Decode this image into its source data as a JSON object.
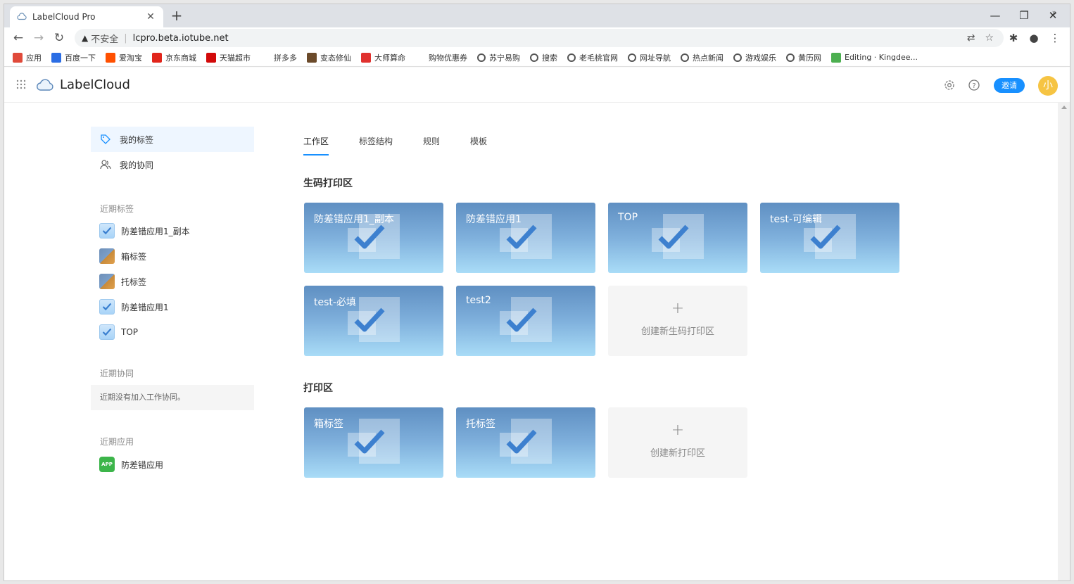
{
  "browser": {
    "tab_title": "LabelCloud Pro",
    "insecure_label": "不安全",
    "url": "lcpro.beta.iotube.net",
    "bookmarks": [
      {
        "label": "应用",
        "color": "#e04a3a",
        "icon": "apps-grid-icon"
      },
      {
        "label": "百度一下",
        "color": "#2b6de4",
        "icon": "paw-icon"
      },
      {
        "label": "爱淘宝",
        "color": "#ff5000",
        "icon": "taobao-icon"
      },
      {
        "label": "京东商城",
        "color": "#e1251b",
        "icon": "jd-icon"
      },
      {
        "label": "天猫超市",
        "color": "#d20a0a",
        "icon": "tmall-icon"
      },
      {
        "label": "拼多多",
        "color": "#ffffff",
        "icon": "blank-icon"
      },
      {
        "label": "变态修仙",
        "color": "#6b4a2a",
        "icon": "game-icon"
      },
      {
        "label": "大师算命",
        "color": "#e0312e",
        "icon": "yinyang-icon"
      },
      {
        "label": "购物优惠券",
        "color": "#ffffff",
        "icon": "blank-icon"
      },
      {
        "label": "苏宁易购",
        "color": "#555555",
        "icon": "globe-icon"
      },
      {
        "label": "搜索",
        "color": "#555555",
        "icon": "globe-icon"
      },
      {
        "label": "老毛桃官网",
        "color": "#555555",
        "icon": "globe-icon"
      },
      {
        "label": "网址导航",
        "color": "#555555",
        "icon": "globe-icon"
      },
      {
        "label": "热点新闻",
        "color": "#555555",
        "icon": "globe-icon"
      },
      {
        "label": "游戏娱乐",
        "color": "#555555",
        "icon": "globe-icon"
      },
      {
        "label": "黄历网",
        "color": "#555555",
        "icon": "globe-icon"
      },
      {
        "label": "Editing · Kingdee...",
        "color": "#4caf50",
        "icon": "edit-icon"
      }
    ],
    "bookmarks_more": "»",
    "new_tab": "+",
    "close": "✕",
    "minimize": "—",
    "restore": "❐",
    "window_close": "✕"
  },
  "header": {
    "brand": "LabelCloud",
    "invite_label": "邀请",
    "avatar_text": "小"
  },
  "sidebar": {
    "my_labels": "我的标签",
    "my_collab": "我的协同",
    "recent_labels_title": "近期标签",
    "recent_labels": [
      {
        "name": "防差错应用1_副本",
        "kind": "check"
      },
      {
        "name": "箱标签",
        "kind": "box"
      },
      {
        "name": "托标签",
        "kind": "box"
      },
      {
        "name": "防差错应用1",
        "kind": "check"
      },
      {
        "name": "TOP",
        "kind": "check"
      }
    ],
    "recent_collab_title": "近期协同",
    "recent_collab_empty": "近期没有加入工作协同。",
    "recent_apps_title": "近期应用",
    "app_badge": "APP",
    "recent_app": "防差错应用"
  },
  "main": {
    "tabs": [
      "工作区",
      "标签结构",
      "规则",
      "模板"
    ],
    "section1_title": "生码打印区",
    "section1_cards": [
      "防差错应用1_副本",
      "防差错应用1",
      "TOP",
      "test-可编辑",
      "test-必填",
      "test2"
    ],
    "section1_add": "创建新生码打印区",
    "section2_title": "打印区",
    "section2_cards": [
      "箱标签",
      "托标签"
    ],
    "section2_add": "创建新打印区",
    "plus": "+"
  },
  "colors": {
    "accent": "#1890ff",
    "avatar": "#f6c443",
    "app_badge": "#3cb54a"
  }
}
